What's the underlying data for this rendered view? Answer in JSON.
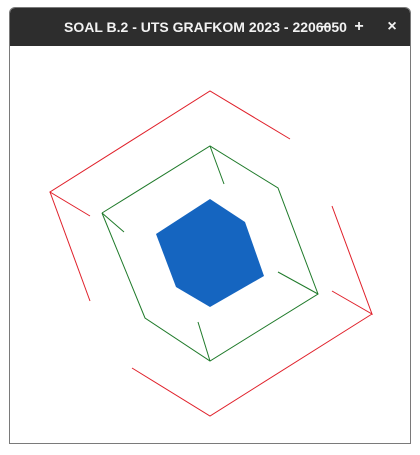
{
  "window": {
    "title": "SOAL B.2 - UTS GRAFKOM 2023 - 2206050",
    "controls": {
      "minimize": "–",
      "maximize": "+",
      "close": "×"
    }
  },
  "colors": {
    "titlebar": "#2d2d2d",
    "outer_frame": "#e0202a",
    "middle_frame": "#1f7a2a",
    "center_hexagon": "#1565c0"
  }
}
